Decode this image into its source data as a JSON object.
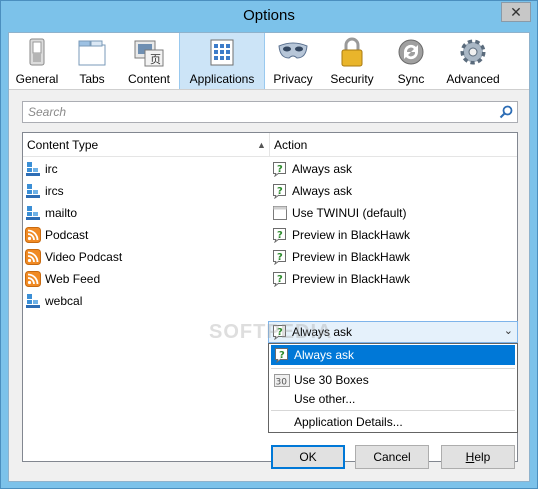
{
  "window": {
    "title": "Options",
    "close_glyph": "✕"
  },
  "toolbar": {
    "items": [
      {
        "label": "General",
        "icon": "general-icon",
        "selected": false
      },
      {
        "label": "Tabs",
        "icon": "tabs-icon",
        "selected": false
      },
      {
        "label": "Content",
        "icon": "content-icon",
        "selected": false
      },
      {
        "label": "Applications",
        "icon": "applications-icon",
        "selected": true
      },
      {
        "label": "Privacy",
        "icon": "privacy-mask-icon",
        "selected": false
      },
      {
        "label": "Security",
        "icon": "padlock-icon",
        "selected": false
      },
      {
        "label": "Sync",
        "icon": "sync-icon",
        "selected": false
      },
      {
        "label": "Advanced",
        "icon": "gear-icon",
        "selected": false
      }
    ]
  },
  "search": {
    "placeholder": "Search"
  },
  "table": {
    "headers": {
      "content_type": "Content Type",
      "action": "Action"
    },
    "rows": [
      {
        "type": "irc",
        "type_icon": "network-icon",
        "action": "Always ask",
        "action_icon": "ask-icon"
      },
      {
        "type": "ircs",
        "type_icon": "network-icon",
        "action": "Always ask",
        "action_icon": "ask-icon"
      },
      {
        "type": "mailto",
        "type_icon": "network-icon",
        "action": "Use TWINUI (default)",
        "action_icon": "window-icon"
      },
      {
        "type": "Podcast",
        "type_icon": "feed-icon",
        "action": "Preview in BlackHawk",
        "action_icon": "ask-icon"
      },
      {
        "type": "Video Podcast",
        "type_icon": "feed-icon",
        "action": "Preview in BlackHawk",
        "action_icon": "ask-icon"
      },
      {
        "type": "Web Feed",
        "type_icon": "feed-icon",
        "action": "Preview in BlackHawk",
        "action_icon": "ask-icon"
      },
      {
        "type": "webcal",
        "type_icon": "network-icon",
        "action": "Always ask",
        "action_icon": "ask-icon"
      }
    ]
  },
  "dropdown": {
    "selected": "Always ask",
    "options": [
      {
        "label": "Always ask",
        "icon": "ask-icon",
        "highlighted": true
      },
      {
        "label": "Use 30 Boxes",
        "icon": "30-boxes-icon",
        "highlighted": false
      },
      {
        "label": "Use other...",
        "icon": "",
        "highlighted": false
      },
      {
        "label": "Application Details...",
        "icon": "",
        "highlighted": false
      }
    ]
  },
  "watermark": "SOFTPEDIA",
  "buttons": {
    "ok": "OK",
    "cancel": "Cancel",
    "help_h": "H",
    "help_rest": "elp"
  },
  "colors": {
    "selection_blue": "#0078d7",
    "titlebar": "#7cc2ea",
    "toolbar_selected": "#cce4f7"
  }
}
